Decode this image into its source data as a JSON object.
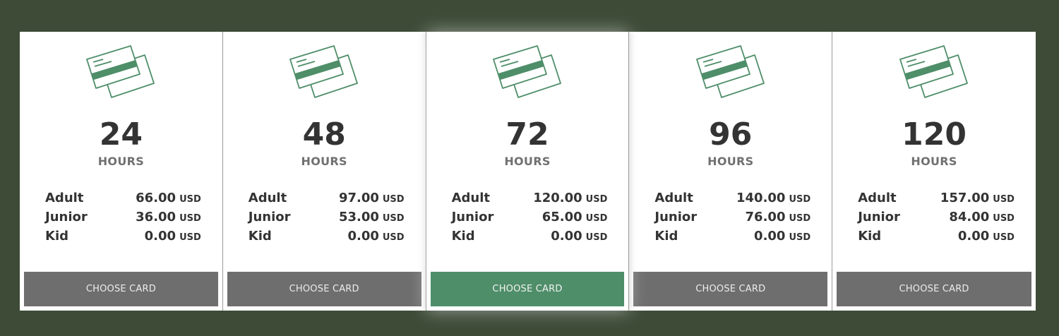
{
  "colors": {
    "background": "#3d4b37",
    "card": "#ffffff",
    "accent_green": "#4e8e69",
    "button_gray": "#6e6e6e",
    "text_dark": "#333333",
    "text_muted": "#707070"
  },
  "cards": [
    {
      "icon": "credit-card-icon",
      "hours": "24",
      "hours_label": "HOURS",
      "featured": false,
      "prices": [
        {
          "name": "Adult",
          "amount": "66.00",
          "currency": "USD"
        },
        {
          "name": "Junior",
          "amount": "36.00",
          "currency": "USD"
        },
        {
          "name": "Kid",
          "amount": "0.00",
          "currency": "USD"
        }
      ],
      "button_label": "CHOOSE CARD"
    },
    {
      "icon": "credit-card-icon",
      "hours": "48",
      "hours_label": "HOURS",
      "featured": false,
      "prices": [
        {
          "name": "Adult",
          "amount": "97.00",
          "currency": "USD"
        },
        {
          "name": "Junior",
          "amount": "53.00",
          "currency": "USD"
        },
        {
          "name": "Kid",
          "amount": "0.00",
          "currency": "USD"
        }
      ],
      "button_label": "CHOOSE CARD"
    },
    {
      "icon": "credit-card-icon",
      "hours": "72",
      "hours_label": "HOURS",
      "featured": true,
      "prices": [
        {
          "name": "Adult",
          "amount": "120.00",
          "currency": "USD"
        },
        {
          "name": "Junior",
          "amount": "65.00",
          "currency": "USD"
        },
        {
          "name": "Kid",
          "amount": "0.00",
          "currency": "USD"
        }
      ],
      "button_label": "CHOOSE CARD"
    },
    {
      "icon": "credit-card-icon",
      "hours": "96",
      "hours_label": "HOURS",
      "featured": false,
      "prices": [
        {
          "name": "Adult",
          "amount": "140.00",
          "currency": "USD"
        },
        {
          "name": "Junior",
          "amount": "76.00",
          "currency": "USD"
        },
        {
          "name": "Kid",
          "amount": "0.00",
          "currency": "USD"
        }
      ],
      "button_label": "CHOOSE CARD"
    },
    {
      "icon": "credit-card-icon",
      "hours": "120",
      "hours_label": "HOURS",
      "featured": false,
      "prices": [
        {
          "name": "Adult",
          "amount": "157.00",
          "currency": "USD"
        },
        {
          "name": "Junior",
          "amount": "84.00",
          "currency": "USD"
        },
        {
          "name": "Kid",
          "amount": "0.00",
          "currency": "USD"
        }
      ],
      "button_label": "CHOOSE CARD"
    }
  ]
}
